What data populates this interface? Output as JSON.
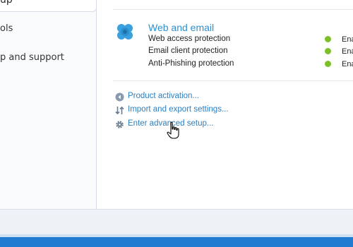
{
  "sidebar": {
    "active_label": "up",
    "items": [
      {
        "label": "ols"
      },
      {
        "label": "p and support"
      }
    ]
  },
  "section": {
    "title": "Web and email",
    "icon": "web-email-icon",
    "features": [
      {
        "name": "Web access protection",
        "status": "Ena"
      },
      {
        "name": "Email client protection",
        "status": "Ena"
      },
      {
        "name": "Anti-Phishing protection",
        "status": "Ena"
      }
    ],
    "status_color": "#7cc028"
  },
  "links": [
    {
      "label": "Product activation...",
      "icon": "activation-icon"
    },
    {
      "label": "Import and export settings...",
      "icon": "import-export-icon"
    },
    {
      "label": "Enter advanced setup...",
      "icon": "gear-icon"
    }
  ],
  "colors": {
    "accent": "#2b8fd0",
    "link": "#2a7fc2",
    "taskbar": "#1f7ccf"
  }
}
